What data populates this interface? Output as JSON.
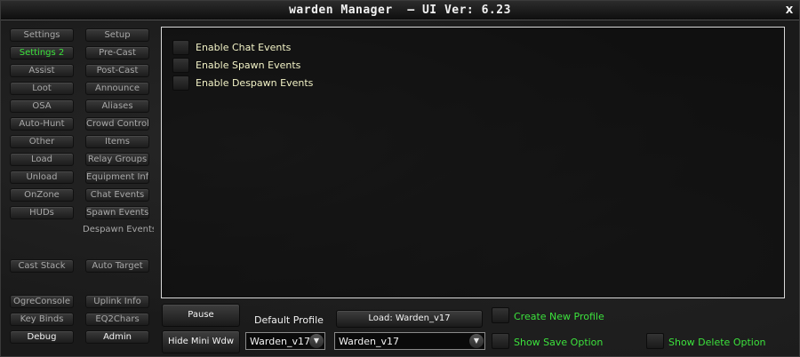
{
  "window": {
    "title": "warden Manager  — UI Ver: 6.23",
    "close_label": "X"
  },
  "nav": {
    "left": [
      {
        "label": "Settings",
        "state": "normal"
      },
      {
        "label": "Settings 2",
        "state": "active"
      },
      {
        "label": "Assist",
        "state": "normal"
      },
      {
        "label": "Loot",
        "state": "normal"
      },
      {
        "label": "OSA",
        "state": "normal"
      },
      {
        "label": "Auto-Hunt",
        "state": "normal"
      },
      {
        "label": "Other",
        "state": "normal"
      },
      {
        "label": "Load",
        "state": "normal"
      },
      {
        "label": "Unload",
        "state": "normal"
      },
      {
        "label": "OnZone",
        "state": "normal"
      },
      {
        "label": "HUDs",
        "state": "normal"
      }
    ],
    "right": [
      {
        "label": "Setup"
      },
      {
        "label": "Pre-Cast"
      },
      {
        "label": "Post-Cast"
      },
      {
        "label": "Announce"
      },
      {
        "label": "Aliases"
      },
      {
        "label": "Crowd Control"
      },
      {
        "label": "Items"
      },
      {
        "label": "Relay Groups"
      },
      {
        "label": "Equipment Info"
      },
      {
        "label": "Chat Events"
      },
      {
        "label": "Spawn Events"
      },
      {
        "label": "Despawn Events"
      }
    ],
    "cast_stack": "Cast Stack",
    "auto_target": "Auto Target",
    "ogre_console": "OgreConsole",
    "uplink_info": "Uplink Info",
    "key_binds": "Key Binds",
    "eq2chars": "EQ2Chars",
    "debug": "Debug",
    "admin": "Admin"
  },
  "content": {
    "options": [
      {
        "label": "Enable Chat Events",
        "checked": false
      },
      {
        "label": "Enable Spawn Events",
        "checked": false
      },
      {
        "label": "Enable Despawn Events",
        "checked": false
      }
    ]
  },
  "bottom": {
    "pause_label": "Pause",
    "hide_mini_label": "Hide Mini Wdw",
    "default_profile_label": "Default Profile",
    "default_profile_value": "Warden_v17",
    "load_label": "Load: Warden_v17",
    "profile_select_value": "Warden_v17",
    "create_new_profile": "Create New Profile",
    "show_save_option": "Show Save Option",
    "show_delete_option": "Show Delete Option"
  },
  "colors": {
    "accent_green": "#3ce23c",
    "option_text": "#f2f2c6",
    "panel_border": "#d8d8d8"
  }
}
